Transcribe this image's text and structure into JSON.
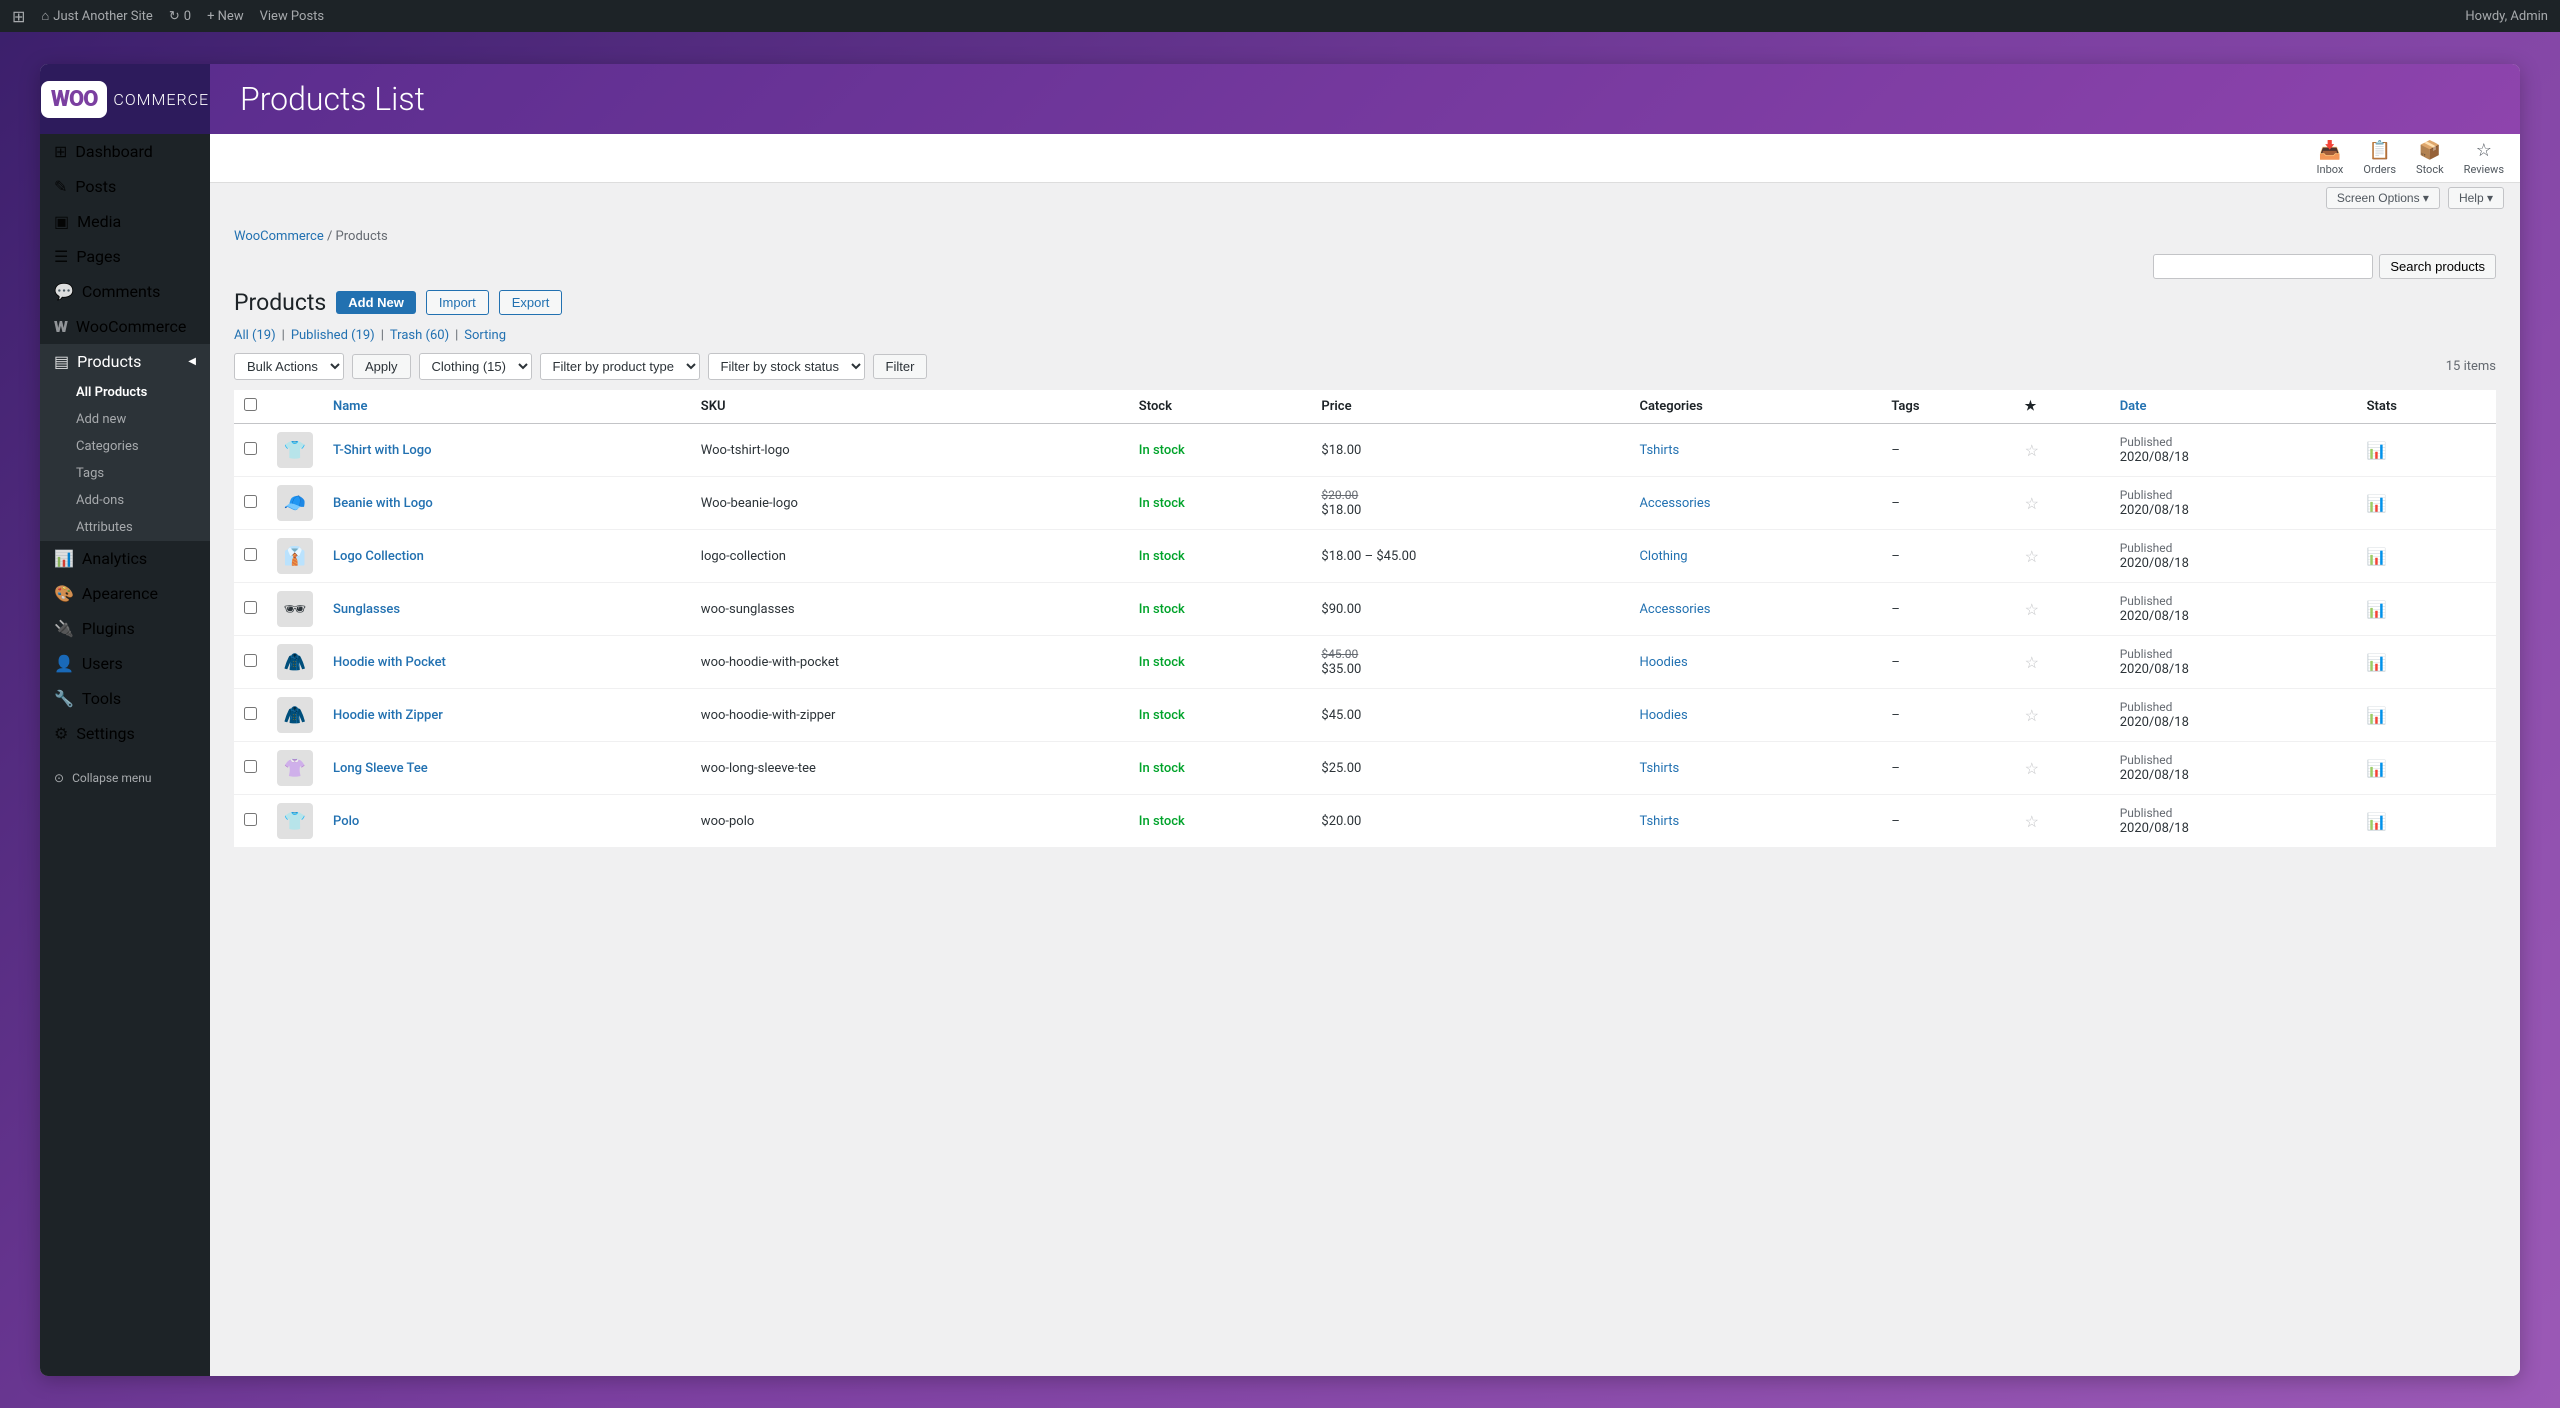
{
  "topBar": {
    "wpIcon": "⊞",
    "siteIcon": "⌂",
    "siteName": "Just Another Site",
    "updateIcon": "↻",
    "updateCount": "0",
    "newLabel": "+ New",
    "viewPosts": "View Posts",
    "howdy": "Howdy, Admin"
  },
  "header": {
    "logoText": "WOO",
    "commerceText": "COMMERCE",
    "pageTitle": "Products List"
  },
  "sidebar": {
    "items": [
      {
        "id": "dashboard",
        "icon": "⊞",
        "label": "Dashboard"
      },
      {
        "id": "posts",
        "icon": "✎",
        "label": "Posts"
      },
      {
        "id": "media",
        "icon": "▣",
        "label": "Media"
      },
      {
        "id": "pages",
        "icon": "☰",
        "label": "Pages"
      },
      {
        "id": "comments",
        "icon": "💬",
        "label": "Comments"
      },
      {
        "id": "woocommerce",
        "icon": "W",
        "label": "WooCommerce"
      },
      {
        "id": "products",
        "icon": "▤",
        "label": "Products"
      }
    ],
    "productsSubItems": [
      {
        "id": "all-products",
        "label": "All Products",
        "active": true
      },
      {
        "id": "add-new",
        "label": "Add new"
      },
      {
        "id": "categories",
        "label": "Categories"
      },
      {
        "id": "tags",
        "label": "Tags"
      },
      {
        "id": "add-ons",
        "label": "Add-ons"
      },
      {
        "id": "attributes",
        "label": "Attributes"
      }
    ],
    "bottomItems": [
      {
        "id": "analytics",
        "icon": "📊",
        "label": "Analytics"
      },
      {
        "id": "appearance",
        "icon": "🎨",
        "label": "Apearence"
      },
      {
        "id": "plugins",
        "icon": "🔌",
        "label": "Plugins"
      },
      {
        "id": "users",
        "icon": "👤",
        "label": "Users"
      },
      {
        "id": "tools",
        "icon": "🔧",
        "label": "Tools"
      },
      {
        "id": "settings",
        "icon": "⚙",
        "label": "Settings"
      }
    ],
    "collapseLabel": "Collapse menu"
  },
  "adminIcons": [
    {
      "id": "inbox",
      "icon": "📥",
      "label": "Inbox"
    },
    {
      "id": "orders",
      "icon": "📋",
      "label": "Orders"
    },
    {
      "id": "stock",
      "icon": "📦",
      "label": "Stock"
    },
    {
      "id": "reviews",
      "icon": "☆",
      "label": "Reviews"
    }
  ],
  "topButtons": {
    "screenOptions": "Screen Options ▾",
    "help": "Help ▾"
  },
  "breadcrumb": {
    "woocommerce": "WooCommerce",
    "separator": "/",
    "products": "Products"
  },
  "productsPage": {
    "title": "Products",
    "addNew": "Add New",
    "import": "Import",
    "export": "Export"
  },
  "filterLinks": {
    "all": "All (19)",
    "published": "Published (19)",
    "trash": "Trash (60)",
    "sorting": "Sorting",
    "separator": "|"
  },
  "toolbar": {
    "bulkActions": "Bulk Actions",
    "apply": "Apply",
    "clothingFilter": "Clothing (15)",
    "productTypeFilter": "Filter by product type",
    "stockStatusFilter": "Filter by stock status",
    "filterBtn": "Filter",
    "itemsCount": "15 items"
  },
  "search": {
    "placeholder": "",
    "buttonLabel": "Search products"
  },
  "tableHeaders": {
    "name": "Name",
    "sku": "SKU",
    "stock": "Stock",
    "price": "Price",
    "categories": "Categories",
    "tags": "Tags",
    "star": "★",
    "date": "Date",
    "stats": "Stats"
  },
  "products": [
    {
      "id": 1,
      "thumb": "👕",
      "name": "T-Shirt with Logo",
      "sku": "Woo-tshirt-logo",
      "stock": "In stock",
      "price": "$18.00",
      "priceOriginal": "",
      "categories": "Tshirts",
      "tags": "–",
      "starred": false,
      "dateStatus": "Published",
      "date": "2020/08/18"
    },
    {
      "id": 2,
      "thumb": "🧢",
      "name": "Beanie with Logo",
      "sku": "Woo-beanie-logo",
      "stock": "In stock",
      "price": "$18.00",
      "priceOriginal": "$20.00",
      "categories": "Accessories",
      "tags": "–",
      "starred": false,
      "dateStatus": "Published",
      "date": "2020/08/18"
    },
    {
      "id": 3,
      "thumb": "👔",
      "name": "Logo Collection",
      "sku": "logo-collection",
      "stock": "In stock",
      "price": "$18.00 – $45.00",
      "priceOriginal": "",
      "categories": "Clothing",
      "tags": "–",
      "starred": false,
      "dateStatus": "Published",
      "date": "2020/08/18"
    },
    {
      "id": 4,
      "thumb": "🕶",
      "name": "Sunglasses",
      "sku": "woo-sunglasses",
      "stock": "In stock",
      "price": "$90.00",
      "priceOriginal": "",
      "categories": "Accessories",
      "tags": "–",
      "starred": false,
      "dateStatus": "Published",
      "date": "2020/08/18"
    },
    {
      "id": 5,
      "thumb": "🧥",
      "name": "Hoodie with Pocket",
      "sku": "woo-hoodie-with-pocket",
      "stock": "In stock",
      "price": "$35.00",
      "priceOriginal": "$45.00",
      "categories": "Hoodies",
      "tags": "–",
      "starred": false,
      "dateStatus": "Published",
      "date": "2020/08/18"
    },
    {
      "id": 6,
      "thumb": "🧥",
      "name": "Hoodie with Zipper",
      "sku": "woo-hoodie-with-zipper",
      "stock": "In stock",
      "price": "$45.00",
      "priceOriginal": "",
      "categories": "Hoodies",
      "tags": "–",
      "starred": false,
      "dateStatus": "Published",
      "date": "2020/08/18"
    },
    {
      "id": 7,
      "thumb": "👚",
      "name": "Long Sleeve Tee",
      "sku": "woo-long-sleeve-tee",
      "stock": "In stock",
      "price": "$25.00",
      "priceOriginal": "",
      "categories": "Tshirts",
      "tags": "–",
      "starred": false,
      "dateStatus": "Published",
      "date": "2020/08/18"
    },
    {
      "id": 8,
      "thumb": "👕",
      "name": "Polo",
      "sku": "woo-polo",
      "stock": "In stock",
      "price": "$20.00",
      "priceOriginal": "",
      "categories": "Tshirts",
      "tags": "–",
      "starred": false,
      "dateStatus": "Published",
      "date": "2020/08/18"
    }
  ]
}
